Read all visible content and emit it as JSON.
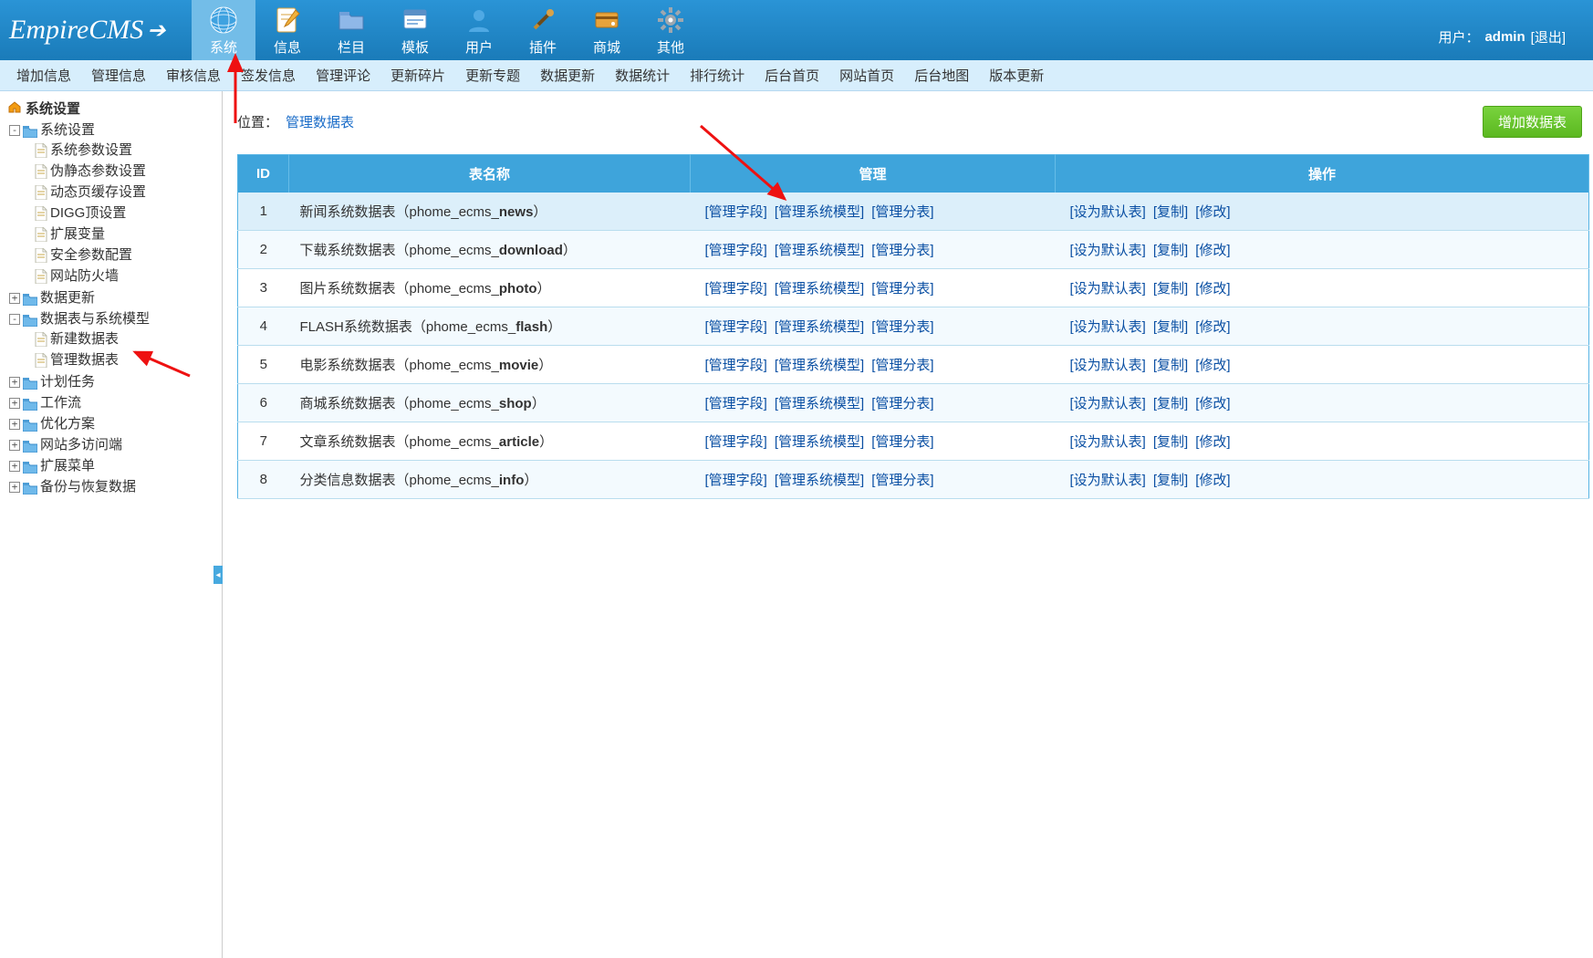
{
  "brand": {
    "name": "EmpireCMS"
  },
  "user": {
    "prefix": "用户：",
    "name": "admin",
    "logout": "[退出]"
  },
  "top_tabs": [
    {
      "label": "系统",
      "icon": "globe"
    },
    {
      "label": "信息",
      "icon": "pencil-doc"
    },
    {
      "label": "栏目",
      "icon": "folder"
    },
    {
      "label": "模板",
      "icon": "window"
    },
    {
      "label": "用户",
      "icon": "person"
    },
    {
      "label": "插件",
      "icon": "tools"
    },
    {
      "label": "商城",
      "icon": "card"
    },
    {
      "label": "其他",
      "icon": "gear"
    }
  ],
  "submenu": [
    "增加信息",
    "管理信息",
    "审核信息",
    "签发信息",
    "管理评论",
    "更新碎片",
    "更新专题",
    "数据更新",
    "数据统计",
    "排行统计",
    "后台首页",
    "网站首页",
    "后台地图",
    "版本更新"
  ],
  "sidebar": {
    "title": "系统设置",
    "nodes": [
      {
        "label": "系统设置",
        "expanded": true,
        "children": [
          {
            "label": "系统参数设置"
          },
          {
            "label": "伪静态参数设置"
          },
          {
            "label": "动态页缓存设置"
          },
          {
            "label": "DIGG顶设置"
          },
          {
            "label": "扩展变量"
          },
          {
            "label": "安全参数配置"
          },
          {
            "label": "网站防火墙"
          }
        ]
      },
      {
        "label": "数据更新",
        "expanded": false
      },
      {
        "label": "数据表与系统模型",
        "expanded": true,
        "children": [
          {
            "label": "新建数据表"
          },
          {
            "label": "管理数据表"
          }
        ]
      },
      {
        "label": "计划任务",
        "expanded": false
      },
      {
        "label": "工作流",
        "expanded": false
      },
      {
        "label": "优化方案",
        "expanded": false
      },
      {
        "label": "网站多访问端",
        "expanded": false
      },
      {
        "label": "扩展菜单",
        "expanded": false
      },
      {
        "label": "备份与恢复数据",
        "expanded": false
      }
    ]
  },
  "breadcrumb": {
    "label": "位置：",
    "current": "管理数据表"
  },
  "add_button": "增加数据表",
  "table": {
    "headers": {
      "id": "ID",
      "name": "表名称",
      "manage": "管理",
      "ops": "操作"
    },
    "manage_links": [
      "管理字段",
      "管理系统模型",
      "管理分表"
    ],
    "ops_links": [
      "设为默认表",
      "复制",
      "修改"
    ],
    "rows": [
      {
        "id": "1",
        "title": "新闻系统数据表",
        "prefix": "phome_ecms_",
        "suffix": "news"
      },
      {
        "id": "2",
        "title": "下载系统数据表",
        "prefix": "phome_ecms_",
        "suffix": "download"
      },
      {
        "id": "3",
        "title": "图片系统数据表",
        "prefix": "phome_ecms_",
        "suffix": "photo"
      },
      {
        "id": "4",
        "title": "FLASH系统数据表",
        "prefix": "phome_ecms_",
        "suffix": "flash"
      },
      {
        "id": "5",
        "title": "电影系统数据表",
        "prefix": "phome_ecms_",
        "suffix": "movie"
      },
      {
        "id": "6",
        "title": "商城系统数据表",
        "prefix": "phome_ecms_",
        "suffix": "shop"
      },
      {
        "id": "7",
        "title": "文章系统数据表",
        "prefix": "phome_ecms_",
        "suffix": "article"
      },
      {
        "id": "8",
        "title": "分类信息数据表",
        "prefix": "phome_ecms_",
        "suffix": "info"
      }
    ]
  }
}
